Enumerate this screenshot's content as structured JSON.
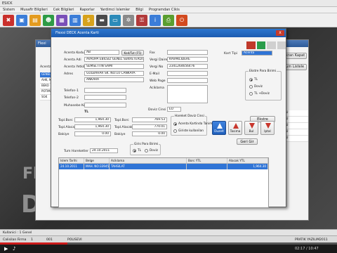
{
  "app": {
    "title": "ESICK",
    "menu": [
      "Sistem",
      "Musafir Bilgileri",
      "Cek Bilgileri",
      "Raporlar",
      "Yardimci Islemler",
      "Bilgi",
      "Programdan Cikis"
    ],
    "desktop_text": "D",
    "desktop_text_small": "Fl"
  },
  "bg_window": {
    "title": "Flexi",
    "left_label": "Acenta Adi",
    "rows": [
      "GENEL",
      "AHK, MEDI",
      "BEKO",
      "POTIMA",
      "SGK"
    ],
    "right_rows": [
      "EU",
      "EU",
      "EU",
      "EU",
      "EU"
    ],
    "right_top_btn": "Ekran Kapat",
    "right_tum_btn": "Tum Listele"
  },
  "dialog": {
    "title": "Flexsi DECK   Acenta Karti",
    "close_label": "x",
    "fields": {
      "acenta_kodu_label": "Acenta Kodu",
      "acenta_kodu": "AB",
      "kodliste_btn": "Kod/Tut (F5)",
      "acenta_adi_label": "Acenta Adi",
      "acenta_adi": "AVRUPA EBILSIZ GENEL SEKRETERLIGI",
      "acenta_yetkili_label": "Acenta Yetkilisi",
      "acenta_yetkili": "SEMSETTIN SAMI",
      "adres_label": "Adres",
      "adres1": "GULBAHAR SK. NO:10 CANKAYA",
      "adres2": "ANKARA",
      "telefon1_label": "Telefon-1",
      "telefon2_label": "Telefon-2",
      "muhasebe_label": "Muhasebe Kodu",
      "fax_label": "Fax",
      "vergi_dairesi_label": "Vergi Dairesi",
      "vergi_dairesi": "KAVAKLIDERE",
      "vergi_no_label": "Vergi No",
      "vergi_no": "2341264656476",
      "email_label": "E-Mail",
      "web_label": "Web Page",
      "aciklama_label": "Aciklama",
      "kart_tipi_label": "Kart Tipi",
      "kart_tipi": "Acenta",
      "doviz_label": "Doviz Cinsi",
      "doviz": "EU",
      "tl_label": "TL"
    },
    "totals": {
      "borc_label": "Topl.Borc",
      "borc_tl": "1,964.30",
      "alacak_label": "Topl.Alacak",
      "alacak_tl": "1,964.30",
      "bakiye_label": "Bakiye",
      "bakiye_tl": "0.00",
      "borc_doviz": "769.53",
      "alacak_doviz": "770.01",
      "bakiye_doviz": "0.00"
    },
    "hareket_group": {
      "title": "Hareket Doviz Cinsi",
      "opt1": "Acenta Kartinda Tanimli",
      "opt2": "Giriste kullanilan"
    },
    "ekstre_group": {
      "title": "Ekstre Para Birimi",
      "opt1": "TL",
      "opt2": "Doviz",
      "opt3": "TL +Doviz"
    },
    "ekstre_btn": "Ekstre",
    "buttons": [
      "Kaydet",
      "Yeni",
      "Sil",
      "Iptal"
    ],
    "action_buttons": [
      "Duzelt",
      "Tasima",
      "Bul",
      "Iptal"
    ],
    "geri_btn": "Geri Gir",
    "tum_hareket_label": "Tum Hareketler",
    "tarih_value": "24.10.2011",
    "giris_para_label": "Giris Para Birimi",
    "giris_opt1": "TL",
    "giris_opt2": "Doviz",
    "grid": {
      "headers": [
        "Islem Tarihi",
        "Belge",
        "Aciklama",
        "Borc YTL",
        "Alacak YTL"
      ],
      "rows": [
        [
          "24.10.2011",
          "MAH. NO:339459",
          "TAHSILAT",
          "",
          "1,964.30"
        ]
      ]
    }
  },
  "status": {
    "kullanici_label": "Kullanici",
    "kullanici": "1 Genel",
    "calisilan_label": "Calisilan Firma",
    "firma_no": "1",
    "firma": "001",
    "firma_ad": "POLISEVI",
    "pratik": "PRATIK YAZILIM",
    "yil": "2011",
    "time": "02:17 / 10:47"
  },
  "player": {
    "progress": 0.2
  }
}
